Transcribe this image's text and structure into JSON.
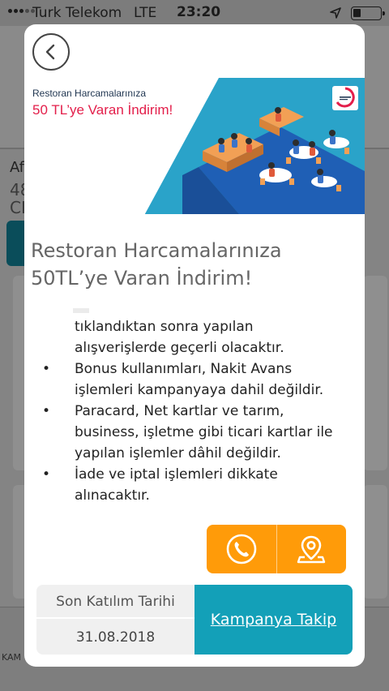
{
  "status_bar": {
    "carrier": "Turk Telekom",
    "network": "LTE",
    "time": "23:20",
    "signal_bars": 3,
    "signal_total": 5,
    "battery_level": 0.2
  },
  "background": {
    "title_fragment": "Af",
    "line1_fragment": "48",
    "line2_fragment": "CI",
    "tab_label_fragment": "KAM"
  },
  "modal": {
    "back_icon": "chevron-left-icon",
    "banner": {
      "line1": "Restoran Harcamalarınıza",
      "line2": "50 TL’ye Varan İndirim!",
      "brand_colors": {
        "teal": "#2aa3c9",
        "red": "#e31e4a"
      }
    },
    "headline": "Restoran Harcamalarınıza 50TL’ye Varan İndirim!",
    "terms": {
      "continuation": [
        "tıklandıktan sonra yapılan",
        "alışverişlerde geçerli olacaktır."
      ],
      "bullets": [
        {
          "marker": "•",
          "lines": [
            "Bonus kullanımları, Nakit Avans",
            "işlemleri kampanyaya dahil değildir."
          ]
        },
        {
          "marker": "•",
          "lines": [
            "Paracard, Net kartlar ve tarım,",
            "business, işletme gibi ticari kartlar ile",
            "yapılan işlemler dâhil değildir."
          ]
        },
        {
          "marker": "•",
          "lines": [
            "İade ve iptal işlemleri dikkate",
            "alınacaktır."
          ]
        }
      ]
    },
    "actions": {
      "call_icon": "phone-icon",
      "location_icon": "map-pin-icon",
      "accent": "#ff9b09"
    },
    "footer": {
      "last_date_label": "Son Katılım Tarihi",
      "last_date_value": "31.08.2018",
      "follow_label": "Kampanya Takip",
      "follow_color": "#13a0b8"
    }
  }
}
